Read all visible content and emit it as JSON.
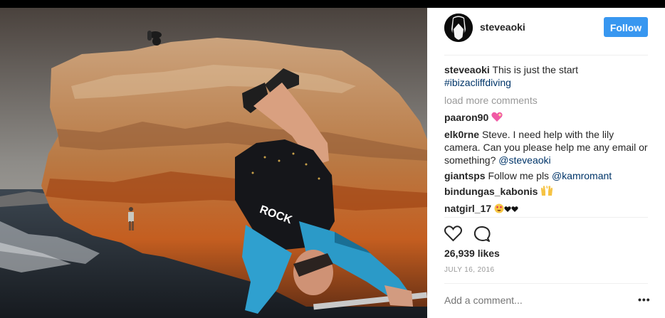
{
  "post": {
    "username": "steveaoki",
    "follow_label": "Follow",
    "caption_user": "steveaoki",
    "caption_text": "This is just the start",
    "caption_hashtag": "#ibizacliffdiving",
    "load_more": "load more comments",
    "comments": [
      {
        "user": "paaron90",
        "text": "",
        "emoji": "sparkling-heart-icon"
      },
      {
        "user": "elk0rne",
        "text": "Steve. I need help with the lily camera. Can you please help me any email or something?",
        "mention": "@steveaoki"
      },
      {
        "user": "giantsps",
        "text": "Follow me pls",
        "mention": "@kamromant"
      },
      {
        "user": "bindungas_kabonis",
        "text": "",
        "emoji": "raised-hands-icon"
      },
      {
        "user": "natgirl_17",
        "text": "",
        "emoji": "heart-eyes-hearts-icon"
      }
    ],
    "likes": "26,939 likes",
    "date": "JULY 16, 2016",
    "add_comment_placeholder": "Add a comment...",
    "more_options": "•••"
  },
  "icons": {
    "like": "heart-outline-icon",
    "comment": "speech-bubble-icon"
  },
  "colors": {
    "follow_button": "#3897f0",
    "hashtag_link": "#003569",
    "muted_text": "#999999"
  }
}
